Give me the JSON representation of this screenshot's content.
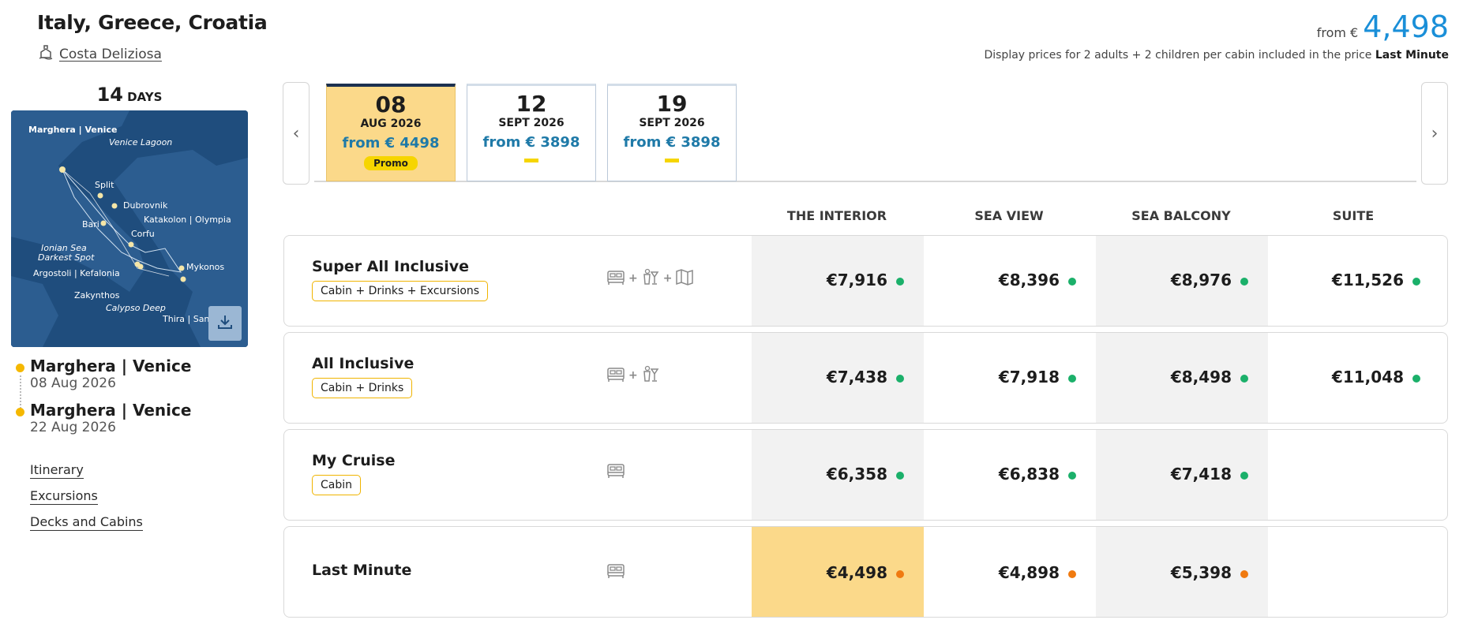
{
  "header": {
    "title": "Italy, Greece, Croatia",
    "ship": "Costa Deliziosa",
    "from_label": "from €",
    "from_price": "4,498",
    "display_note": "Display prices for 2 adults + 2 children per cabin included in the price",
    "display_note_bold": "Last Minute"
  },
  "itinerary": {
    "days_number": "14",
    "days_label": "DAYS",
    "map_labels": [
      "Marghera | Venice",
      "Venice Lagoon",
      "Split",
      "Dubrovnik",
      "Bari",
      "Katakolon | Olympia",
      "Corfu",
      "Ionian Sea",
      "Darkest Spot",
      "Argostoli | Kefalonia",
      "Mykonos",
      "Zakynthos",
      "Calypso Deep",
      "Thira | Santorini"
    ],
    "stops": [
      {
        "name": "Marghera | Venice",
        "date": "08 Aug 2026"
      },
      {
        "name": "Marghera | Venice",
        "date": "22 Aug 2026"
      }
    ],
    "links": [
      "Itinerary",
      "Excursions",
      "Decks and Cabins"
    ],
    "download_icon": "download-icon"
  },
  "dates": [
    {
      "day": "08",
      "month": "AUG 2026",
      "price": "from € 4498",
      "promo": "Promo",
      "active": true
    },
    {
      "day": "12",
      "month": "SEPT 2026",
      "price": "from € 3898",
      "promo": "",
      "active": false
    },
    {
      "day": "19",
      "month": "SEPT 2026",
      "price": "from € 3898",
      "promo": "",
      "active": false
    }
  ],
  "columns": [
    "THE INTERIOR",
    "SEA VIEW",
    "SEA BALCONY",
    "SUITE"
  ],
  "rows": [
    {
      "name": "Super All Inclusive",
      "tag": "Cabin + Drinks + Excursions",
      "icons": [
        "bed-icon",
        "drinks-icon",
        "map-icon"
      ],
      "prices": [
        "€7,916",
        "€8,396",
        "€8,976",
        "€11,526"
      ],
      "dot": "green",
      "highlight": false
    },
    {
      "name": "All Inclusive",
      "tag": "Cabin + Drinks",
      "icons": [
        "bed-icon",
        "drinks-icon"
      ],
      "prices": [
        "€7,438",
        "€7,918",
        "€8,498",
        "€11,048"
      ],
      "dot": "green",
      "highlight": false
    },
    {
      "name": "My Cruise",
      "tag": "Cabin",
      "icons": [
        "bed-icon"
      ],
      "prices": [
        "€6,358",
        "€6,838",
        "€7,418",
        ""
      ],
      "dot": "green",
      "highlight": false
    },
    {
      "name": "Last Minute",
      "tag": "",
      "icons": [
        "bed-icon"
      ],
      "prices": [
        "€4,498",
        "€4,898",
        "€5,398",
        ""
      ],
      "dot": "orange",
      "highlight": true
    }
  ],
  "colors": {
    "accent_blue": "#1a8fd8",
    "promo_yellow": "#f6d500",
    "highlight": "#fbd98a",
    "green_dot": "#1bb06a",
    "orange_dot": "#f07a10"
  }
}
